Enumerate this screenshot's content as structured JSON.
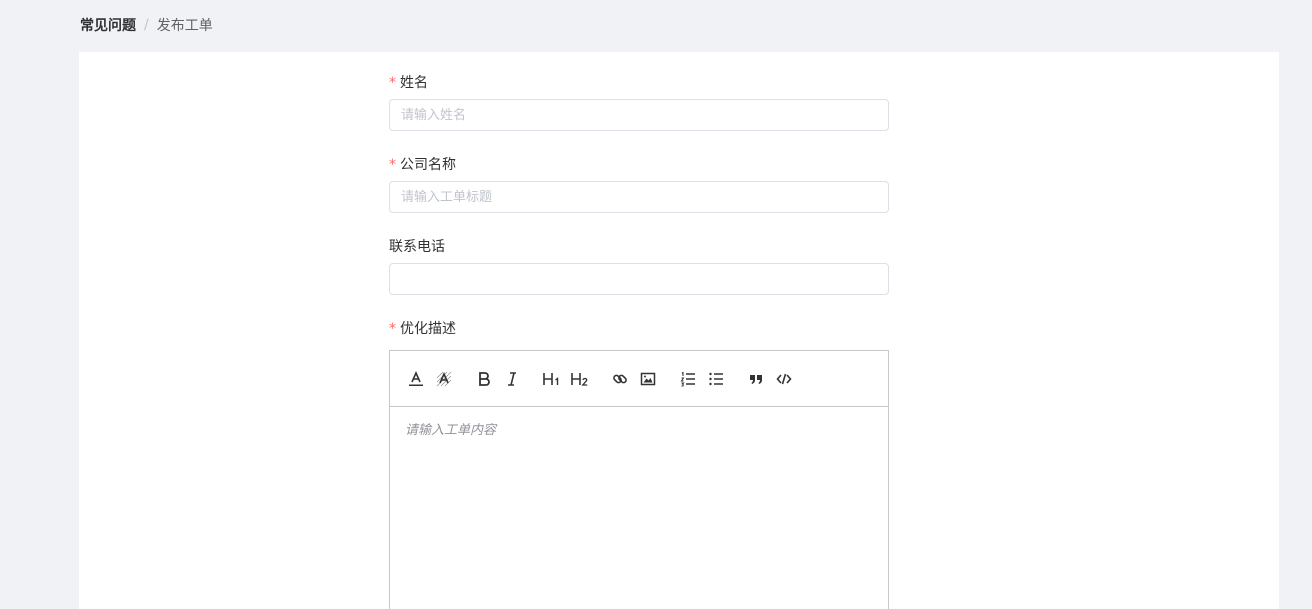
{
  "breadcrumb": {
    "items": [
      "常见问题",
      "发布工单"
    ],
    "separator": "/"
  },
  "form": {
    "name": {
      "label": "姓名",
      "required_mark": "*",
      "placeholder": "请输入姓名",
      "value": ""
    },
    "company": {
      "label": "公司名称",
      "required_mark": "*",
      "placeholder": "请输入工单标题",
      "value": ""
    },
    "phone": {
      "label": "联系电话",
      "placeholder": "",
      "value": ""
    },
    "description": {
      "label": "优化描述",
      "required_mark": "*",
      "placeholder": "请输入工单内容",
      "toolbar": [
        {
          "icon": "font-color-icon"
        },
        {
          "icon": "background-color-icon"
        },
        {
          "icon": "bold-icon"
        },
        {
          "icon": "italic-icon"
        },
        {
          "icon": "heading-1-icon"
        },
        {
          "icon": "heading-2-icon"
        },
        {
          "icon": "link-icon"
        },
        {
          "icon": "image-icon"
        },
        {
          "icon": "ordered-list-icon"
        },
        {
          "icon": "bullet-list-icon"
        },
        {
          "icon": "quote-icon"
        },
        {
          "icon": "code-icon"
        }
      ]
    }
  },
  "colors": {
    "page_bg": "#f0f2f5",
    "required": "#f56c6c",
    "placeholder": "#c0c4cc",
    "border": "#dcdfe6"
  }
}
